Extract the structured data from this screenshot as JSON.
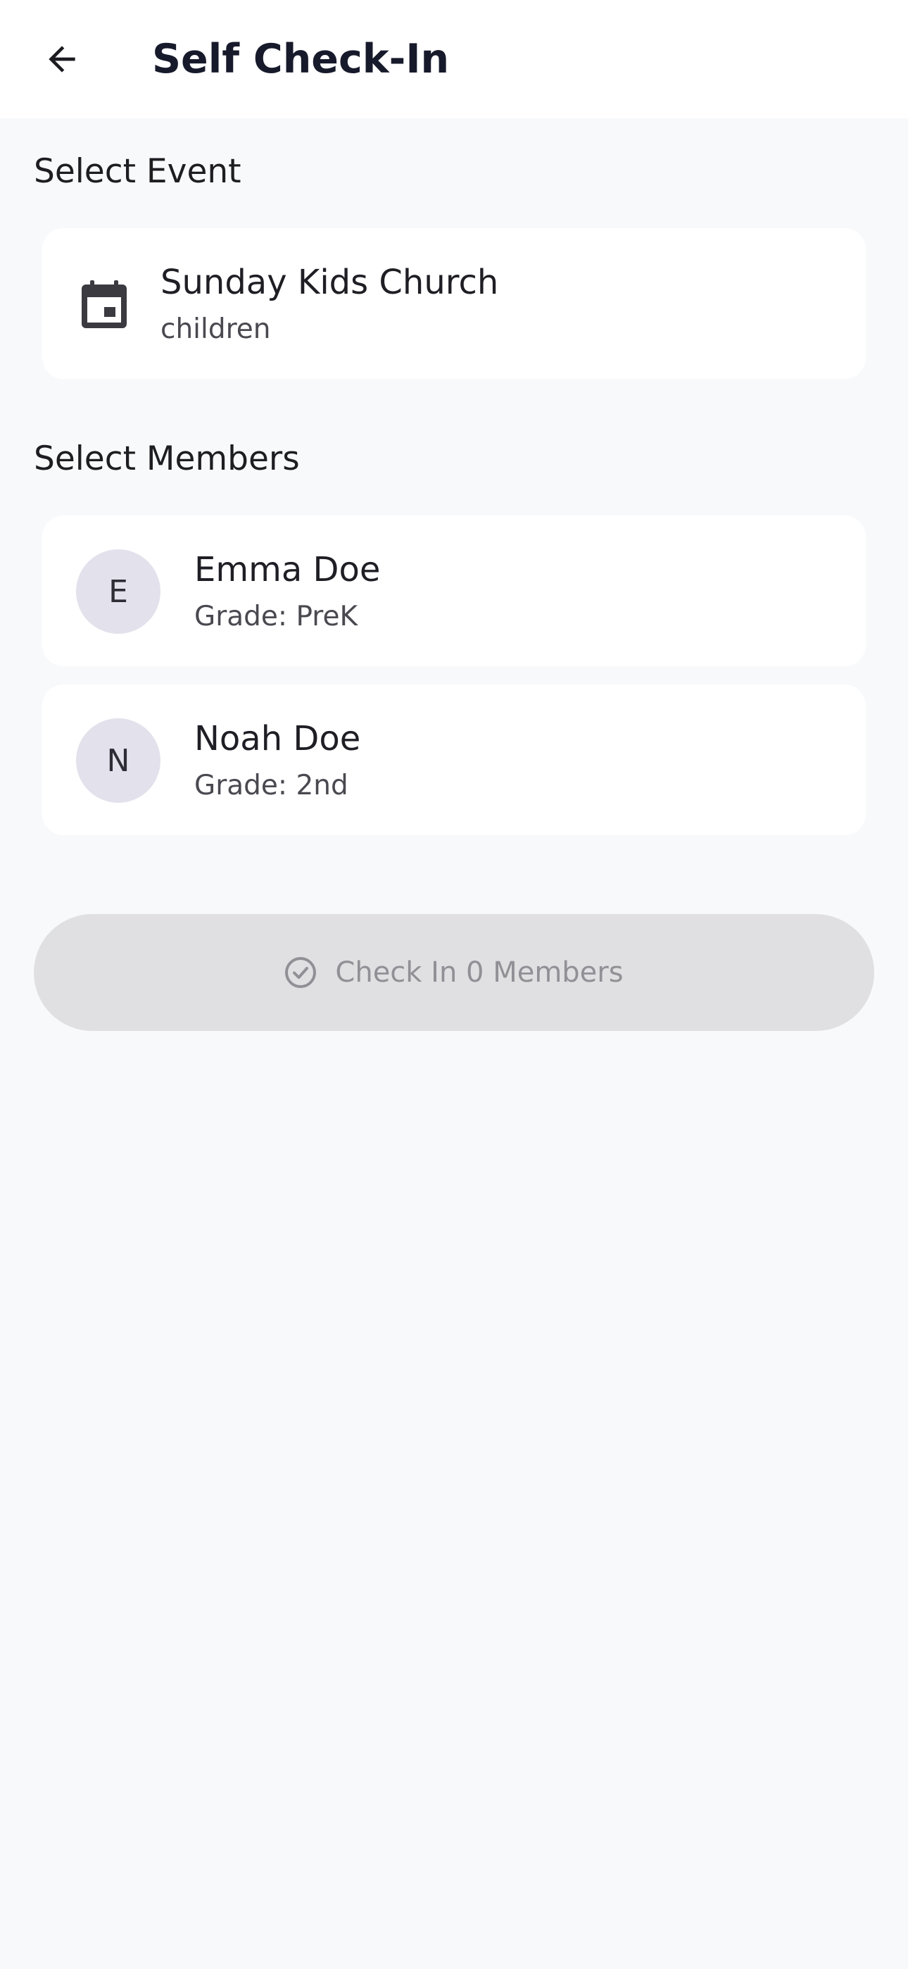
{
  "header": {
    "title": "Self Check-In",
    "back_icon": "arrow-left-icon"
  },
  "event_section": {
    "label": "Select Event",
    "event": {
      "icon": "calendar-icon",
      "title": "Sunday Kids Church",
      "subtitle": "children"
    }
  },
  "members_section": {
    "label": "Select Members",
    "members": [
      {
        "initial": "E",
        "name": "Emma Doe",
        "grade": "Grade: PreK"
      },
      {
        "initial": "N",
        "name": "Noah Doe",
        "grade": "Grade: 2nd"
      }
    ]
  },
  "checkin_button": {
    "label": "Check In 0 Members",
    "icon": "check-circle-icon",
    "enabled": false
  },
  "colors": {
    "background": "#f8f9fb",
    "card": "#ffffff",
    "avatar_bg": "#e3e1eb",
    "button_disabled_bg": "#e0e0e2",
    "button_disabled_text": "#919096",
    "title_text": "#171a2b"
  }
}
